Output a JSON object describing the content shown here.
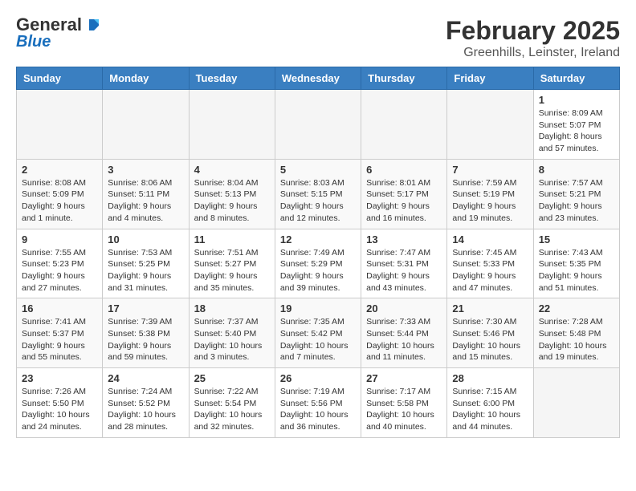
{
  "header": {
    "logo_general": "General",
    "logo_blue": "Blue",
    "main_title": "February 2025",
    "sub_title": "Greenhills, Leinster, Ireland"
  },
  "weekdays": [
    "Sunday",
    "Monday",
    "Tuesday",
    "Wednesday",
    "Thursday",
    "Friday",
    "Saturday"
  ],
  "weeks": [
    [
      {
        "day": "",
        "info": ""
      },
      {
        "day": "",
        "info": ""
      },
      {
        "day": "",
        "info": ""
      },
      {
        "day": "",
        "info": ""
      },
      {
        "day": "",
        "info": ""
      },
      {
        "day": "",
        "info": ""
      },
      {
        "day": "1",
        "info": "Sunrise: 8:09 AM\nSunset: 5:07 PM\nDaylight: 8 hours and 57 minutes."
      }
    ],
    [
      {
        "day": "2",
        "info": "Sunrise: 8:08 AM\nSunset: 5:09 PM\nDaylight: 9 hours and 1 minute."
      },
      {
        "day": "3",
        "info": "Sunrise: 8:06 AM\nSunset: 5:11 PM\nDaylight: 9 hours and 4 minutes."
      },
      {
        "day": "4",
        "info": "Sunrise: 8:04 AM\nSunset: 5:13 PM\nDaylight: 9 hours and 8 minutes."
      },
      {
        "day": "5",
        "info": "Sunrise: 8:03 AM\nSunset: 5:15 PM\nDaylight: 9 hours and 12 minutes."
      },
      {
        "day": "6",
        "info": "Sunrise: 8:01 AM\nSunset: 5:17 PM\nDaylight: 9 hours and 16 minutes."
      },
      {
        "day": "7",
        "info": "Sunrise: 7:59 AM\nSunset: 5:19 PM\nDaylight: 9 hours and 19 minutes."
      },
      {
        "day": "8",
        "info": "Sunrise: 7:57 AM\nSunset: 5:21 PM\nDaylight: 9 hours and 23 minutes."
      }
    ],
    [
      {
        "day": "9",
        "info": "Sunrise: 7:55 AM\nSunset: 5:23 PM\nDaylight: 9 hours and 27 minutes."
      },
      {
        "day": "10",
        "info": "Sunrise: 7:53 AM\nSunset: 5:25 PM\nDaylight: 9 hours and 31 minutes."
      },
      {
        "day": "11",
        "info": "Sunrise: 7:51 AM\nSunset: 5:27 PM\nDaylight: 9 hours and 35 minutes."
      },
      {
        "day": "12",
        "info": "Sunrise: 7:49 AM\nSunset: 5:29 PM\nDaylight: 9 hours and 39 minutes."
      },
      {
        "day": "13",
        "info": "Sunrise: 7:47 AM\nSunset: 5:31 PM\nDaylight: 9 hours and 43 minutes."
      },
      {
        "day": "14",
        "info": "Sunrise: 7:45 AM\nSunset: 5:33 PM\nDaylight: 9 hours and 47 minutes."
      },
      {
        "day": "15",
        "info": "Sunrise: 7:43 AM\nSunset: 5:35 PM\nDaylight: 9 hours and 51 minutes."
      }
    ],
    [
      {
        "day": "16",
        "info": "Sunrise: 7:41 AM\nSunset: 5:37 PM\nDaylight: 9 hours and 55 minutes."
      },
      {
        "day": "17",
        "info": "Sunrise: 7:39 AM\nSunset: 5:38 PM\nDaylight: 9 hours and 59 minutes."
      },
      {
        "day": "18",
        "info": "Sunrise: 7:37 AM\nSunset: 5:40 PM\nDaylight: 10 hours and 3 minutes."
      },
      {
        "day": "19",
        "info": "Sunrise: 7:35 AM\nSunset: 5:42 PM\nDaylight: 10 hours and 7 minutes."
      },
      {
        "day": "20",
        "info": "Sunrise: 7:33 AM\nSunset: 5:44 PM\nDaylight: 10 hours and 11 minutes."
      },
      {
        "day": "21",
        "info": "Sunrise: 7:30 AM\nSunset: 5:46 PM\nDaylight: 10 hours and 15 minutes."
      },
      {
        "day": "22",
        "info": "Sunrise: 7:28 AM\nSunset: 5:48 PM\nDaylight: 10 hours and 19 minutes."
      }
    ],
    [
      {
        "day": "23",
        "info": "Sunrise: 7:26 AM\nSunset: 5:50 PM\nDaylight: 10 hours and 24 minutes."
      },
      {
        "day": "24",
        "info": "Sunrise: 7:24 AM\nSunset: 5:52 PM\nDaylight: 10 hours and 28 minutes."
      },
      {
        "day": "25",
        "info": "Sunrise: 7:22 AM\nSunset: 5:54 PM\nDaylight: 10 hours and 32 minutes."
      },
      {
        "day": "26",
        "info": "Sunrise: 7:19 AM\nSunset: 5:56 PM\nDaylight: 10 hours and 36 minutes."
      },
      {
        "day": "27",
        "info": "Sunrise: 7:17 AM\nSunset: 5:58 PM\nDaylight: 10 hours and 40 minutes."
      },
      {
        "day": "28",
        "info": "Sunrise: 7:15 AM\nSunset: 6:00 PM\nDaylight: 10 hours and 44 minutes."
      },
      {
        "day": "",
        "info": ""
      }
    ]
  ]
}
